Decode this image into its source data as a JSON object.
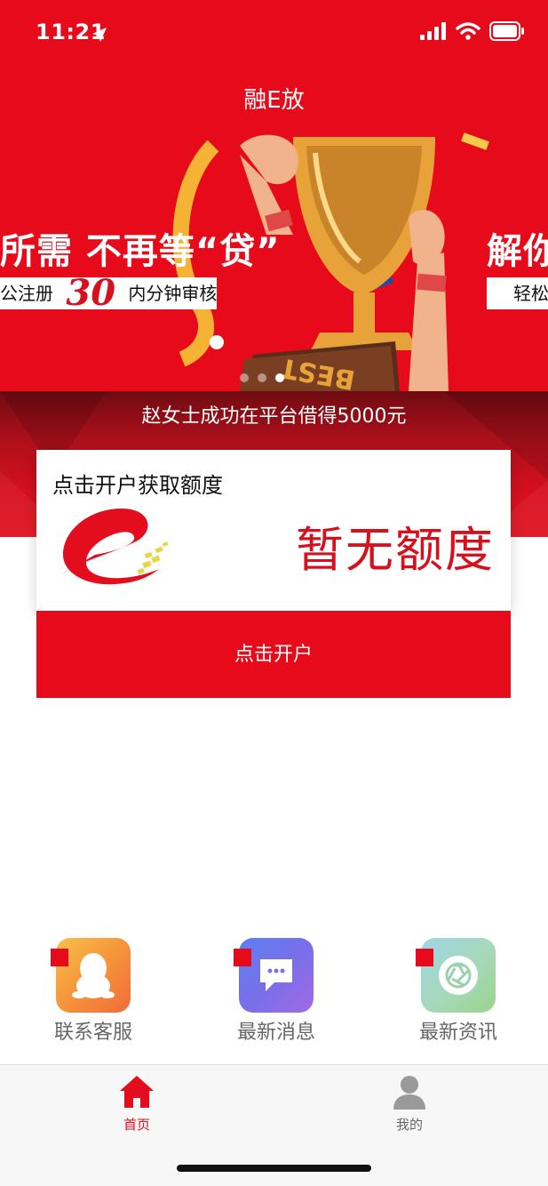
{
  "status_bar": {
    "time": "11:21"
  },
  "nav": {
    "title": "融E放"
  },
  "banner": {
    "headline_left": "所需 不再等“贷”",
    "sub_left_before": "公注册",
    "sub_left_number": "30",
    "sub_left_after": "内分钟审核",
    "headline_right": "解你",
    "sub_right": "轻松",
    "trophy_text": "BEST",
    "slide_count": 3,
    "active_slide": 2
  },
  "ticker": {
    "text": "赵女士成功在平台借得5000元"
  },
  "quota_card": {
    "prompt": "点击开户获取额度",
    "value": "暂无额度"
  },
  "open_account_button": {
    "label": "点击开户"
  },
  "shortcuts": [
    {
      "label": "联系客服",
      "icon": "qq-penguin-icon"
    },
    {
      "label": "最新消息",
      "icon": "chat-bubble-icon"
    },
    {
      "label": "最新资讯",
      "icon": "aperture-icon"
    }
  ],
  "tabbar": {
    "tabs": [
      {
        "label": "首页",
        "icon": "home-icon",
        "active": true
      },
      {
        "label": "我的",
        "icon": "user-icon",
        "active": false
      }
    ]
  },
  "colors": {
    "brand_red": "#e60a1a",
    "text_red": "#d7101e",
    "muted_gray": "#666666"
  }
}
